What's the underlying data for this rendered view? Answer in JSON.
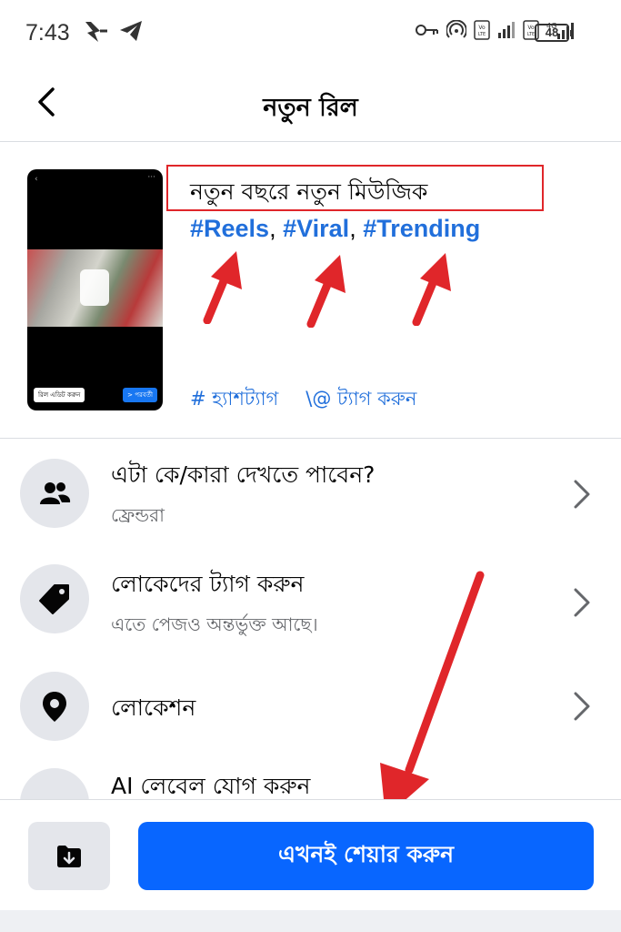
{
  "status_bar": {
    "time": "7:43",
    "battery": "48",
    "icons": [
      "key-icon",
      "hotspot-icon",
      "volte-icon",
      "signal-icon",
      "4g-icon",
      "signal-icon"
    ]
  },
  "header": {
    "title": "নতুন রিল",
    "back_icon": "chevron-left-icon"
  },
  "composer": {
    "caption": "নতুন বছরে নতুন মিউজিক",
    "hashtags": [
      "#Reels",
      "#Viral",
      "#Trending"
    ],
    "hashtag_separator": ",",
    "hashtag_tool": "# হ্যাশট্যাগ",
    "mention_tool": "\\@ ট্যাগ করুন",
    "thumbnail": {
      "edit_label": "রিল এডিট করুন",
      "next_label": "> পরবর্তী"
    }
  },
  "settings": [
    {
      "title": "এটা কে/কারা দেখতে পাবেন?",
      "subtitle": "ফ্রেন্ডরা",
      "icon": "friends-icon"
    },
    {
      "title": "লোকেদের ট্যাগ করুন",
      "subtitle": "এতে পেজও অন্তর্ভুক্ত আছে।",
      "icon": "tag-icon"
    },
    {
      "title": "লোকেশন",
      "subtitle": "",
      "icon": "location-pin-icon"
    },
    {
      "title": "AI লেবেল যোগ করুন",
      "subtitle": "",
      "icon": "ai-label-icon"
    }
  ],
  "bottom": {
    "share_label": "এখনই শেয়ার করুন",
    "draft_icon": "save-draft-icon"
  },
  "colors": {
    "accent": "#0866ff",
    "hashtag": "#216fdb",
    "annotation": "#e0262a",
    "icon_bg": "#e4e6eb"
  }
}
